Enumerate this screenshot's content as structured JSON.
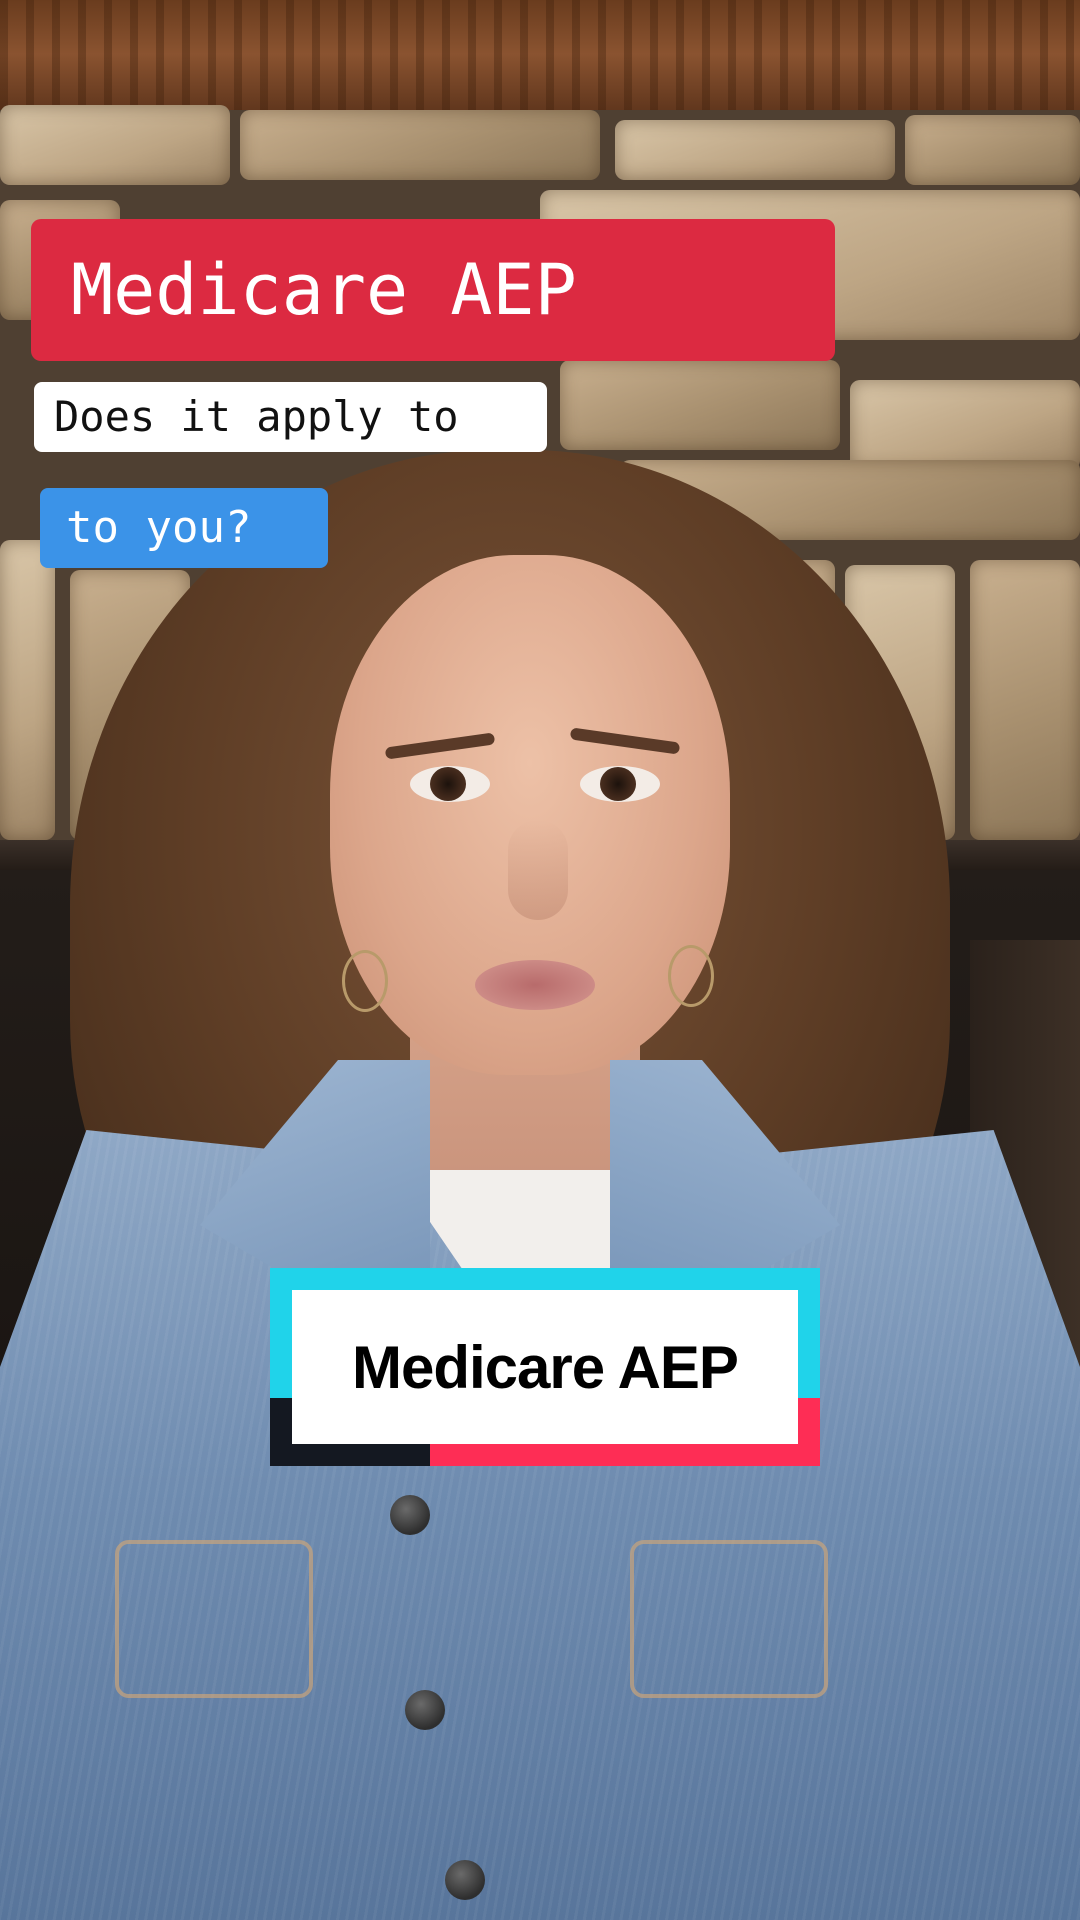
{
  "captions": {
    "title": "Medicare AEP",
    "line1": "Does it apply to",
    "line2": "to you?"
  },
  "sticker": {
    "label": "Medicare AEP"
  },
  "colors": {
    "title_bg": "#dc2a41",
    "line1_bg": "#ffffff",
    "line2_bg": "#3b93e8",
    "sticker_cyan": "#20d3ea",
    "sticker_red": "#fe2d55",
    "sticker_dark": "#141821"
  }
}
